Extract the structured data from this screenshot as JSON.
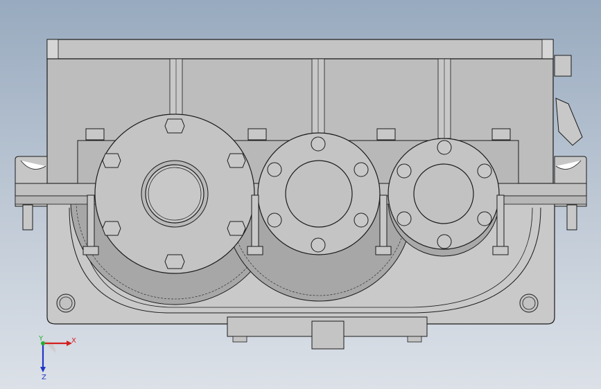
{
  "viewport": {
    "background_top": "#98aabf",
    "background_bottom": "#dce1e8"
  },
  "model": {
    "view": "front",
    "body_color": "#bdbdbd",
    "edge_color": "#1a1a1a",
    "gear_color": "#a9a9a9",
    "flange_color": "#c4c4c4"
  },
  "triad": {
    "x_label": "X",
    "y_label": "Y",
    "z_label": "Z",
    "x_color": "#d42020",
    "y_color": "#1fb030",
    "z_color": "#2036c8"
  }
}
